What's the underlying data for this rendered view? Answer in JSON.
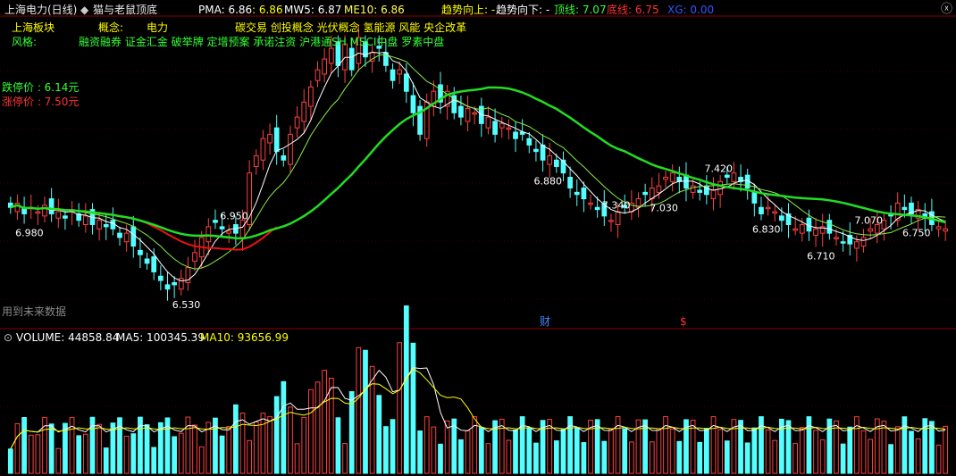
{
  "header": {
    "stock_title": "上海电力(日线)",
    "indicator_name": "猫与老鼠顶底",
    "pma_label": "PMA: 6.86",
    "pma_value": ": 6.86",
    "mw5_label": "MW5: 6.87",
    "me10_label": "ME10: 6.86",
    "trend_up": "趋势向上: -",
    "trend_down": "趋势向下: -",
    "top_line": "顶线: 7.07",
    "bottom_line": "底线: 6.75",
    "xg": "XG: 0.00"
  },
  "info": {
    "board_label": "上海板块",
    "concept_label": "概念:",
    "concept_value": "电力",
    "concept_list": "碳交易 创投概念 光伏概念 氢能源 风能 央企改革",
    "style_label": "风格:",
    "style_list": "融资融券 证金汇金 破举牌 定增预案 承诺注资 沪港通SH MSCI中盘 罗素中盘"
  },
  "limits": {
    "limit_down": "跌停价 : 6.14元",
    "limit_up": "涨停价 : 7.50元"
  },
  "markers": {
    "future_data": "用到未来数据",
    "cai": "财",
    "s": "$"
  },
  "volume_header": {
    "volume": "VOLUME: 44858.84",
    "ma5": "MA5: 100345.39",
    "ma10": "MA10: 93656.99"
  },
  "colors": {
    "up_candle": "#ff4040",
    "down_candle": "#54ffff",
    "ma_green": "#22dd22",
    "ma_red": "#ee1111",
    "ma_white": "#ffffff",
    "vol_ma10": "#ffff00"
  },
  "chart_data": {
    "type": "candlestick",
    "price_range": [
      6.45,
      7.8
    ],
    "closes": [
      6.96,
      6.98,
      6.93,
      6.96,
      6.94,
      6.97,
      6.93,
      6.94,
      6.91,
      6.95,
      6.9,
      6.92,
      6.88,
      6.9,
      6.87,
      6.86,
      6.82,
      6.84,
      6.78,
      6.74,
      6.7,
      6.66,
      6.62,
      6.58,
      6.6,
      6.63,
      6.68,
      6.75,
      6.82,
      6.87,
      6.89,
      6.86,
      6.85,
      6.84,
      6.9,
      7.12,
      7.2,
      7.28,
      7.3,
      7.22,
      7.18,
      7.3,
      7.38,
      7.45,
      7.52,
      7.6,
      7.65,
      7.7,
      7.62,
      7.72,
      7.6,
      7.75,
      7.66,
      7.68,
      7.7,
      7.62,
      7.55,
      7.6,
      7.5,
      7.4,
      7.3,
      7.45,
      7.5,
      7.45,
      7.5,
      7.4,
      7.38,
      7.42,
      7.4,
      7.35,
      7.38,
      7.3,
      7.35,
      7.33,
      7.28,
      7.3,
      7.25,
      7.22,
      7.18,
      7.2,
      7.15,
      7.12,
      7.05,
      7.02,
      7.0,
      6.98,
      6.95,
      6.92,
      6.9,
      6.94,
      6.96,
      6.98,
      7.0,
      7.02,
      7.05,
      7.06,
      7.1,
      7.12,
      7.08,
      7.05,
      7.06,
      7.03,
      7.02,
      7.04,
      7.08,
      7.1,
      7.12,
      7.08,
      7.05,
      6.98,
      6.93,
      6.96,
      6.94,
      6.9,
      6.88,
      6.86,
      6.88,
      6.85,
      6.86,
      6.87,
      6.84,
      6.82,
      6.8,
      6.79,
      6.8,
      6.82,
      6.86,
      6.88,
      6.9,
      6.92,
      6.98,
      6.95,
      6.93,
      6.95,
      6.91,
      6.88,
      6.87,
      6.86
    ],
    "annotations": [
      "6.980",
      "6.530",
      "6.950",
      "6.880",
      "7.340",
      "7.030",
      "7.420",
      "6.830",
      "6.710",
      "7.070",
      "6.750"
    ],
    "volume_range": [
      0,
      160000
    ],
    "volume_current": 44858.84,
    "volume_ma5": 100345.39,
    "volume_ma10": 93656.99
  }
}
